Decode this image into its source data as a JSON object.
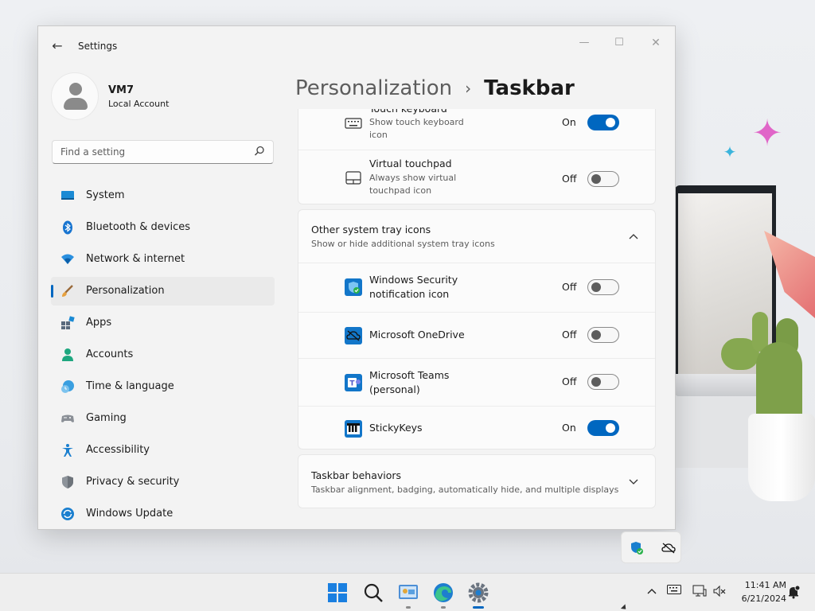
{
  "window": {
    "title": "Settings"
  },
  "profile": {
    "name": "VM7",
    "account_type": "Local Account"
  },
  "search": {
    "placeholder": "Find a setting"
  },
  "sidebar": {
    "items": [
      {
        "label": "System",
        "icon": "system-icon"
      },
      {
        "label": "Bluetooth & devices",
        "icon": "bluetooth-icon"
      },
      {
        "label": "Network & internet",
        "icon": "network-icon"
      },
      {
        "label": "Personalization",
        "icon": "personalization-icon",
        "active": true
      },
      {
        "label": "Apps",
        "icon": "apps-icon"
      },
      {
        "label": "Accounts",
        "icon": "accounts-icon"
      },
      {
        "label": "Time & language",
        "icon": "time-language-icon"
      },
      {
        "label": "Gaming",
        "icon": "gaming-icon"
      },
      {
        "label": "Accessibility",
        "icon": "accessibility-icon"
      },
      {
        "label": "Privacy & security",
        "icon": "privacy-icon"
      },
      {
        "label": "Windows Update",
        "icon": "windows-update-icon"
      }
    ]
  },
  "breadcrumb": {
    "parent": "Personalization",
    "separator": "›",
    "current": "Taskbar"
  },
  "tray_top": {
    "touch_keyboard": {
      "title": "Touch keyboard",
      "subtitle_line1": "Show touch keyboard",
      "subtitle_line2": "icon",
      "state": "On"
    },
    "virtual_touchpad": {
      "title": "Virtual touchpad",
      "subtitle_line1": "Always show virtual",
      "subtitle_line2": "touchpad icon",
      "state": "Off"
    }
  },
  "other_tray": {
    "title": "Other system tray icons",
    "subtitle": "Show or hide additional system tray icons",
    "items": [
      {
        "title_line1": "Windows Security",
        "title_line2": "notification icon",
        "state": "Off",
        "icon": "windows-security-icon"
      },
      {
        "title_line1": "Microsoft OneDrive",
        "title_line2": "",
        "state": "Off",
        "icon": "onedrive-icon"
      },
      {
        "title_line1": "Microsoft Teams",
        "title_line2": "(personal)",
        "state": "Off",
        "icon": "teams-icon"
      },
      {
        "title_line1": "StickyKeys",
        "title_line2": "",
        "state": "On",
        "icon": "stickykeys-icon"
      }
    ]
  },
  "behaviors": {
    "title": "Taskbar behaviors",
    "subtitle": "Taskbar alignment, badging, automatically hide, and multiple displays"
  },
  "clock": {
    "time": "11:41 AM",
    "date": "6/21/2024"
  },
  "colors": {
    "accent": "#0067c0",
    "window_bg": "#f3f3f3",
    "card_bg": "#fbfbfb"
  }
}
